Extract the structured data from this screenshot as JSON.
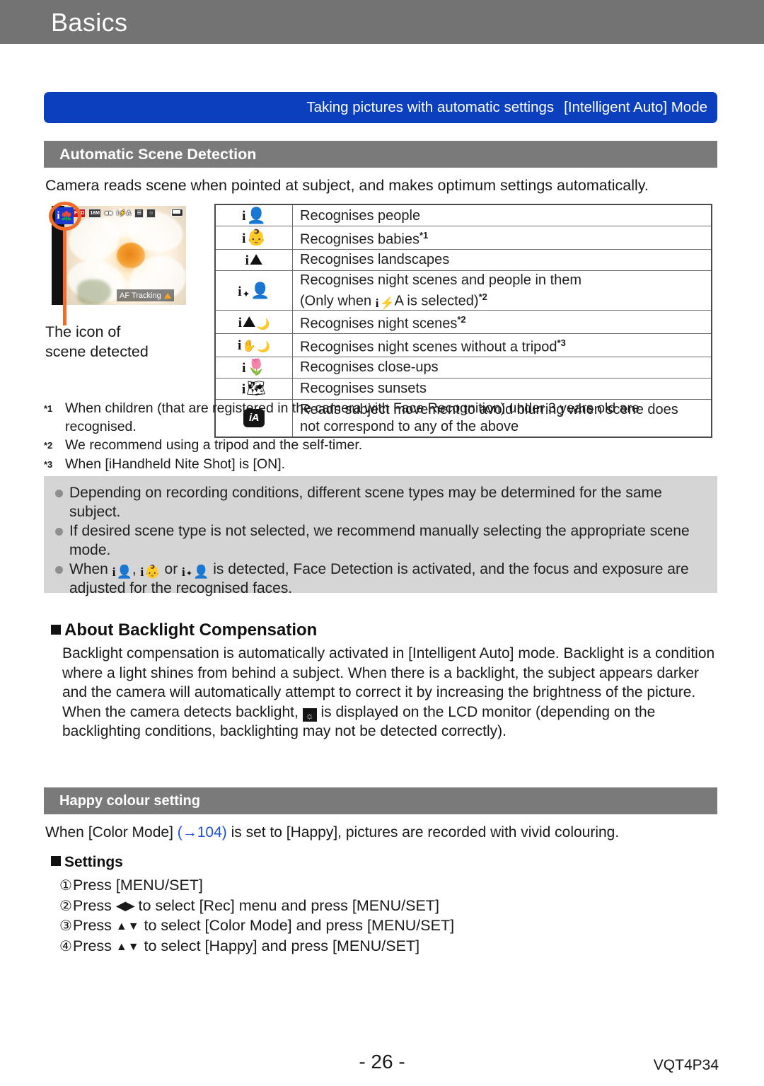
{
  "chapter": {
    "title": "Basics"
  },
  "section_banner": {
    "title": "Taking pictures with automatic settings",
    "mode": "[Intelligent Auto] Mode"
  },
  "scene_detection": {
    "header": "Automatic Scene Detection",
    "intro": "Camera reads scene when pointed at subject, and makes optimum settings automatically.",
    "figure": {
      "caption_line1": "The icon of",
      "caption_line2": "scene detected",
      "lcd_icons": [
        "AVCHD FHD 50i",
        "ISO",
        "quality-icon",
        "iA-flash",
        "stabiliser-icon",
        "face-detect-icon",
        "battery-icon"
      ],
      "af_tracking_label": "AF Tracking",
      "badge_letter": "i"
    },
    "rows": [
      {
        "icon": "i-portrait-icon",
        "text": "Recognises people",
        "note": ""
      },
      {
        "icon": "i-baby-icon",
        "text": "Recognises babies",
        "note": "*1"
      },
      {
        "icon": "i-scenery-icon",
        "text": "Recognises landscapes",
        "note": ""
      },
      {
        "icon": "i-night-portrait-icon",
        "text": "Recognises night scenes and people in them",
        "text2_pre": "(Only when ",
        "text2_mid": "A",
        "text2_post": " is selected)",
        "note": "*2"
      },
      {
        "icon": "i-night-scenery-icon",
        "text": "Recognises night scenes",
        "note": "*2"
      },
      {
        "icon": "i-handheld-night-icon",
        "text": "Recognises night scenes without a tripod",
        "note": "*3"
      },
      {
        "icon": "i-macro-icon",
        "text": "Recognises close-ups",
        "note": ""
      },
      {
        "icon": "i-sunset-icon",
        "text": "Recognises sunsets",
        "note": ""
      },
      {
        "icon": "ia-badge-icon",
        "text": "Reads subject movement to avoid blurring when scene does",
        "text2": "not correspond to any of the above",
        "note": ""
      }
    ],
    "footnotes": [
      {
        "mark": "*1",
        "line1": "When children (that are registered in the camera with Face Recognition) under 3 years old are",
        "line2": "recognised."
      },
      {
        "mark": "*2",
        "line1": "We recommend using a tripod and the self-timer.",
        "line2": ""
      },
      {
        "mark": "*3",
        "line1": "When [iHandheld Nite Shot] is [ON].",
        "line2": ""
      }
    ],
    "notes": [
      {
        "text": "Depending on recording conditions, different scene types may be determined for the same subject."
      },
      {
        "text": "If desired scene type is not selected, we recommend manually selecting the appropriate scene mode."
      },
      {
        "pre": "When ",
        "mid1": ", ",
        "mid2": " or ",
        "post": " is detected, Face Detection is activated, and the focus and exposure are adjusted for the recognised faces."
      }
    ]
  },
  "backlight": {
    "heading": "About Backlight Compensation",
    "body_part1": "Backlight compensation is automatically activated in [Intelligent Auto] mode. Backlight is a condition where a light shines from behind a subject. When there is a backlight, the subject appears darker and the camera will automatically attempt to correct it by increasing the brightness of the picture. When the camera detects backlight, ",
    "body_part2": " is displayed on the LCD monitor (depending on the backlighting conditions, backlighting may not be detected correctly)."
  },
  "happy_colour": {
    "header": "Happy colour setting",
    "line_pre": "When [Color Mode] ",
    "link": "(→104)",
    "line_post": " is set to [Happy], pictures are recorded with vivid colouring.",
    "settings_heading": "Settings",
    "steps": [
      {
        "num": "①",
        "text": "Press [MENU/SET]"
      },
      {
        "num": "②",
        "pre": "Press ",
        "arrows": "◀▶",
        "post": " to select [Rec] menu and press [MENU/SET]"
      },
      {
        "num": "③",
        "pre": "Press ",
        "arrows": "▲▼",
        "post": " to select [Color Mode] and press [MENU/SET]"
      },
      {
        "num": "④",
        "pre": "Press ",
        "arrows": "▲▼",
        "post": " to select [Happy] and press [MENU/SET]"
      }
    ]
  },
  "footer": {
    "page_number": "- 26 -",
    "doc_code": "VQT4P34"
  },
  "colors": {
    "chapter_bar": "#737373",
    "blue_banner": "#0B3FBE",
    "grey_header": "#7a7a7a",
    "notes_box": "#d5d5d5",
    "link": "#1d4ed8",
    "callout": "#ef6c2a"
  }
}
